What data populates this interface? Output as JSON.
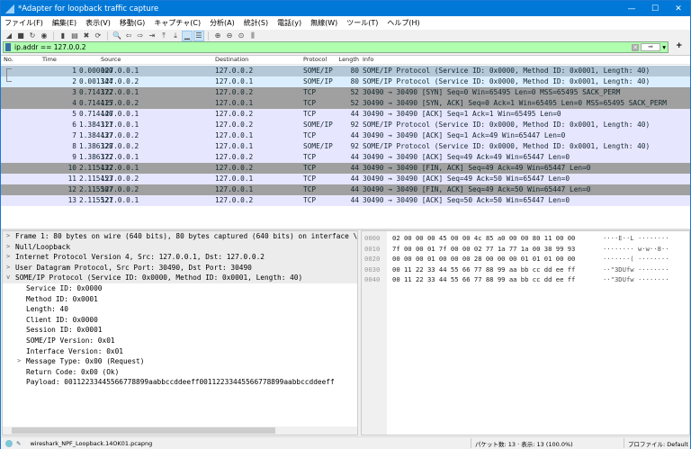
{
  "window": {
    "title": "*Adapter for loopback traffic capture",
    "minimize": "—",
    "maximize": "☐",
    "close": "✕"
  },
  "menu": [
    "ファイル(F)",
    "編集(E)",
    "表示(V)",
    "移動(G)",
    "キャプチャ(C)",
    "分析(A)",
    "統計(S)",
    "電話(y)",
    "無線(W)",
    "ツール(T)",
    "ヘルプ(H)"
  ],
  "toolbar": [
    {
      "name": "start-capture-icon",
      "g": "◢"
    },
    {
      "name": "stop-capture-icon",
      "g": "■"
    },
    {
      "name": "restart-capture-icon",
      "g": "↻"
    },
    {
      "name": "capture-options-icon",
      "g": "◉"
    },
    {
      "sep": true
    },
    {
      "name": "open-file-icon",
      "g": "▮"
    },
    {
      "name": "save-file-icon",
      "g": "▤"
    },
    {
      "name": "close-file-icon",
      "g": "✖"
    },
    {
      "name": "reload-file-icon",
      "g": "⟳"
    },
    {
      "sep": true
    },
    {
      "name": "find-packet-icon",
      "g": "🔍"
    },
    {
      "name": "go-back-icon",
      "g": "⇦"
    },
    {
      "name": "go-forward-icon",
      "g": "⇨"
    },
    {
      "name": "go-to-packet-icon",
      "g": "⇥"
    },
    {
      "name": "go-first-icon",
      "g": "⤒"
    },
    {
      "name": "go-last-icon",
      "g": "⤓"
    },
    {
      "name": "autoscroll-icon",
      "g": "▁",
      "on": true
    },
    {
      "name": "colorize-icon",
      "g": "☰",
      "on": true
    },
    {
      "sep": true
    },
    {
      "name": "zoom-in-icon",
      "g": "⊕"
    },
    {
      "name": "zoom-out-icon",
      "g": "⊖"
    },
    {
      "name": "zoom-reset-icon",
      "g": "⊙"
    },
    {
      "name": "resize-columns-icon",
      "g": "⫼"
    }
  ],
  "filter": {
    "value": "ip.addr == 127.0.0.2",
    "clear": "✕",
    "apply": "➡",
    "dropdown": "▾",
    "add": "+",
    "bg": "#afffaf"
  },
  "packet_list": {
    "columns": [
      "No.",
      "Time",
      "Source",
      "Destination",
      "Protocol",
      "Length",
      "Info"
    ],
    "rows": [
      {
        "no": "1",
        "time": "0.000000",
        "src": "127.0.0.1",
        "dst": "127.0.0.2",
        "proto": "SOME/IP",
        "len": "80",
        "info": "SOME/IP Protocol (Service ID: 0x0000, Method ID: 0x0001, Length: 40)",
        "bg": "#b5c8d8",
        "selected": true
      },
      {
        "no": "2",
        "time": "0.001344",
        "src": "127.0.0.2",
        "dst": "127.0.0.1",
        "proto": "SOME/IP",
        "len": "80",
        "info": "SOME/IP Protocol (Service ID: 0x0000, Method ID: 0x0001, Length: 40)",
        "bg": "#daeeff"
      },
      {
        "no": "3",
        "time": "0.714372",
        "src": "127.0.0.1",
        "dst": "127.0.0.2",
        "proto": "TCP",
        "len": "52",
        "info": "30490 → 30490 [SYN] Seq=0 Win=65495 Len=0 MSS=65495 SACK_PERM",
        "bg": "#a0a0a0"
      },
      {
        "no": "4",
        "time": "0.714415",
        "src": "127.0.0.2",
        "dst": "127.0.0.1",
        "proto": "TCP",
        "len": "52",
        "info": "30490 → 30490 [SYN, ACK] Seq=0 Ack=1 Win=65495 Len=0 MSS=65495 SACK_PERM",
        "bg": "#a0a0a0"
      },
      {
        "no": "5",
        "time": "0.714446",
        "src": "127.0.0.1",
        "dst": "127.0.0.2",
        "proto": "TCP",
        "len": "44",
        "info": "30490 → 30490 [ACK] Seq=1 Ack=1 Win=65495 Len=0",
        "bg": "#e7e6ff"
      },
      {
        "no": "6",
        "time": "1.384311",
        "src": "127.0.0.1",
        "dst": "127.0.0.2",
        "proto": "SOME/IP",
        "len": "92",
        "info": "SOME/IP Protocol (Service ID: 0x0000, Method ID: 0x0001, Length: 40)",
        "bg": "#e7e6ff"
      },
      {
        "no": "7",
        "time": "1.384437",
        "src": "127.0.0.2",
        "dst": "127.0.0.1",
        "proto": "TCP",
        "len": "44",
        "info": "30490 → 30490 [ACK] Seq=1 Ack=49 Win=65447 Len=0",
        "bg": "#e7e6ff"
      },
      {
        "no": "8",
        "time": "1.386328",
        "src": "127.0.0.2",
        "dst": "127.0.0.1",
        "proto": "SOME/IP",
        "len": "92",
        "info": "SOME/IP Protocol (Service ID: 0x0000, Method ID: 0x0001, Length: 40)",
        "bg": "#e7e6ff"
      },
      {
        "no": "9",
        "time": "1.386372",
        "src": "127.0.0.1",
        "dst": "127.0.0.2",
        "proto": "TCP",
        "len": "44",
        "info": "30490 → 30490 [ACK] Seq=49 Ack=49 Win=65447 Len=0",
        "bg": "#e7e6ff"
      },
      {
        "no": "10",
        "time": "2.115432",
        "src": "127.0.0.1",
        "dst": "127.0.0.2",
        "proto": "TCP",
        "len": "44",
        "info": "30490 → 30490 [FIN, ACK] Seq=49 Ack=49 Win=65447 Len=0",
        "bg": "#a0a0a0"
      },
      {
        "no": "11",
        "time": "2.115453",
        "src": "127.0.0.2",
        "dst": "127.0.0.1",
        "proto": "TCP",
        "len": "44",
        "info": "30490 → 30490 [ACK] Seq=49 Ack=50 Win=65447 Len=0",
        "bg": "#e7e6ff"
      },
      {
        "no": "12",
        "time": "2.115507",
        "src": "127.0.0.2",
        "dst": "127.0.0.1",
        "proto": "TCP",
        "len": "44",
        "info": "30490 → 30490 [FIN, ACK] Seq=49 Ack=50 Win=65447 Len=0",
        "bg": "#a0a0a0"
      },
      {
        "no": "13",
        "time": "2.115521",
        "src": "127.0.0.1",
        "dst": "127.0.0.2",
        "proto": "TCP",
        "len": "44",
        "info": "30490 → 30490 [ACK] Seq=50 Ack=50 Win=65447 Len=0",
        "bg": "#e7e6ff"
      }
    ]
  },
  "details": [
    {
      "text": "Frame 1: 80 bytes on wire (640 bits), 80 bytes captured (640 bits) on interface \\D",
      "tw": ">",
      "top": true
    },
    {
      "text": "Null/Loopback",
      "tw": ">",
      "top": true
    },
    {
      "text": "Internet Protocol Version 4, Src: 127.0.0.1, Dst: 127.0.0.2",
      "tw": ">",
      "top": true
    },
    {
      "text": "User Datagram Protocol, Src Port: 30490, Dst Port: 30490",
      "tw": ">",
      "top": true
    },
    {
      "text": "SOME/IP Protocol (Service ID: 0x0000, Method ID: 0x0001, Length: 40)",
      "tw": "v",
      "top": true
    },
    {
      "text": "Service ID: 0x0000",
      "tw": ""
    },
    {
      "text": "Method ID: 0x0001",
      "tw": ""
    },
    {
      "text": "Length: 40",
      "tw": ""
    },
    {
      "text": "Client ID: 0x0000",
      "tw": ""
    },
    {
      "text": "Session ID: 0x0001",
      "tw": ""
    },
    {
      "text": "SOME/IP Version: 0x01",
      "tw": ""
    },
    {
      "text": "Interface Version: 0x01",
      "tw": ""
    },
    {
      "text": "Message Type: 0x00 (Request)",
      "tw": ">"
    },
    {
      "text": "Return Code: 0x00 (Ok)",
      "tw": ""
    },
    {
      "text": "Payload: 00112233445566778899aabbccddeeff00112233445566778899aabbccddeeff",
      "tw": ""
    }
  ],
  "hex": [
    {
      "off": "0000",
      "bytes": "02 00 00 00 45 00 00 4c  85 a0 00 00 80 11 00 00",
      "ascii": "····E··L ········"
    },
    {
      "off": "0010",
      "bytes": "7f 00 00 01 7f 00 00 02  77 1a 77 1a 00 38 99 93",
      "ascii": "········ w·w··8··"
    },
    {
      "off": "0020",
      "bytes": "00 00 00 01 00 00 00 28  00 00 00 01 01 01 00 00",
      "ascii": "·······( ········"
    },
    {
      "off": "0030",
      "bytes": "00 11 22 33 44 55 66 77  88 99 aa bb cc dd ee ff",
      "ascii": "··\"3DUfw ········"
    },
    {
      "off": "0040",
      "bytes": "00 11 22 33 44 55 66 77  88 99 aa bb cc dd ee ff",
      "ascii": "··\"3DUfw ········"
    }
  ],
  "status": {
    "file": "wireshark_NPF_Loopback.14OK01.pcapng",
    "packets": "パケット数: 13 · 表示: 13 (100.0%)",
    "profile": "プロファイル: Default"
  }
}
